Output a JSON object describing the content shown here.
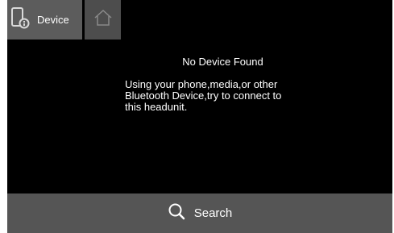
{
  "top_bar": {
    "device_tab": {
      "label": "Device",
      "icon": "phone-icon"
    },
    "home_tab": {
      "icon": "home-icon"
    }
  },
  "content": {
    "title": "No Device Found",
    "message": "Using your phone,media,or other\nBluetooth Device,try to connect to\nthis headunit."
  },
  "bottom_bar": {
    "search_label": "Search",
    "icon": "search-icon"
  },
  "colors": {
    "background": "#000000",
    "device_tab": "#5c5c5c",
    "home_tab": "#4d4d4d",
    "bottom_bar": "#555555",
    "text": "#ffffff"
  }
}
